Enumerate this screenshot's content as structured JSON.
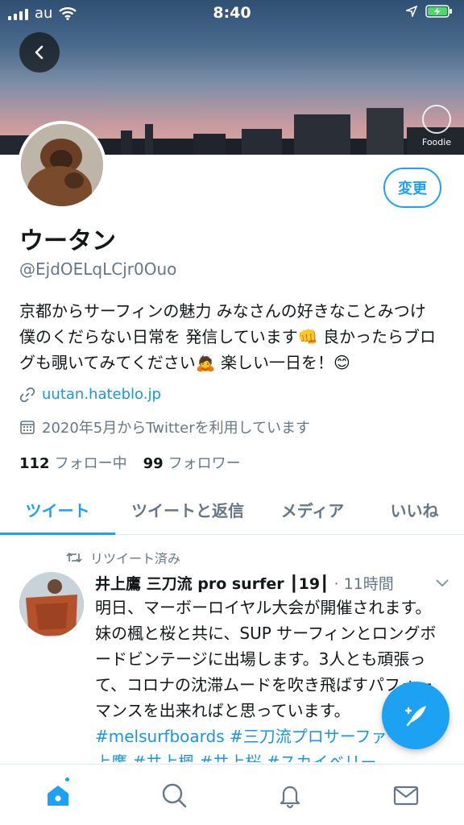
{
  "status_bar": {
    "carrier": "au",
    "time": "8:40"
  },
  "banner": {
    "badge_label": "Foodie"
  },
  "profile": {
    "edit_label": "変更",
    "name": "ウータン",
    "handle": "@EjdOELqLCjr0Ouo",
    "bio": "京都からサーフィンの魅力 みなさんの好きなことみつけ 僕のくだらない日常を 発信しています👊 良かったらブログも覗いてみてください🙇 楽しい一日を！😊",
    "link": "uutan.hateblo.jp",
    "joined": "2020年5月からTwitterを利用しています",
    "following_count": "112",
    "following_label": "フォロー中",
    "followers_count": "99",
    "followers_label": "フォロワー"
  },
  "tabs": [
    {
      "label": "ツイート"
    },
    {
      "label": "ツイートと返信"
    },
    {
      "label": "メディア"
    },
    {
      "label": "いいね"
    }
  ],
  "tweet": {
    "retweet_label": "リツイート済み",
    "author": "井上鷹 三刀流 pro surfer ┃19┃",
    "time": "· 11時間",
    "text": "明日、マーボーロイヤル大会が開催されます。妹の楓と桜と共に、SUP サーフィンとロングボードビンテージに出場します。3人とも頑張って、コロナの沈滞ムードを吹き飛ばすパフォーマンスを出来ればと思っています。",
    "hashtags": "#melsurfboards #三刀流プロサーファー #井上鷹 #井上楓 #井上桜 #スカイベリー"
  },
  "colors": {
    "accent": "#1da1f2",
    "secondary_text": "#657786"
  },
  "icons": [
    "back-arrow-icon",
    "home-icon",
    "search-icon",
    "bell-icon",
    "mail-icon",
    "compose-icon",
    "retweet-icon",
    "link-icon",
    "calendar-icon",
    "chevron-down-icon"
  ]
}
